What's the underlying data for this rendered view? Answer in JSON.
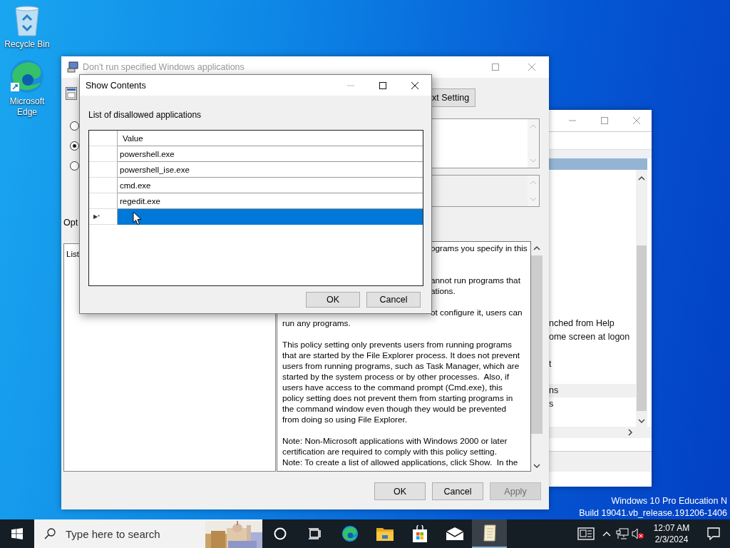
{
  "desktop_icons": [
    {
      "kind": "recycle",
      "label": "Recycle Bin"
    },
    {
      "kind": "edge",
      "label": "Microsoft Edge"
    }
  ],
  "back_window": {
    "items": [
      {
        "text": "nched from Help",
        "selected": false
      },
      {
        "text": "ome screen at logon",
        "selected": false
      },
      {
        "text": "t",
        "selected": false
      },
      {
        "text": "ns",
        "selected": true
      },
      {
        "text": "s",
        "selected": false
      }
    ]
  },
  "policy_window": {
    "title": "Don't run specified Windows applications",
    "active": false,
    "radios": [
      {
        "selected": false
      },
      {
        "selected": true
      },
      {
        "selected": false
      }
    ],
    "next_button": "xt Setting",
    "options_label": "Opt",
    "options_text": "List",
    "help_blocks": [
      {
        "lines": [
          {
            "text": "ograms you specify in this",
            "cut": true
          }
        ]
      },
      {
        "lines": [
          {
            "text": "annot run programs that",
            "cut": true
          },
          {
            "text": "ations.",
            "cut": true
          }
        ]
      },
      {
        "lines": [
          {
            "text": "ot configure it, users can",
            "cut": true
          },
          {
            "text": "run any programs.",
            "cut": false
          }
        ]
      },
      {
        "lines": [
          {
            "text": "This policy setting only prevents users from running programs",
            "cut": false
          },
          {
            "text": "that are started by the File Explorer process. It does not prevent",
            "cut": false
          },
          {
            "text": "users from running programs, such as Task Manager, which are",
            "cut": false
          },
          {
            "text": "started by the system process or by other processes.  Also, if",
            "cut": false
          },
          {
            "text": "users have access to the command prompt (Cmd.exe), this",
            "cut": false
          },
          {
            "text": "policy setting does not prevent them from starting programs in",
            "cut": false
          },
          {
            "text": "the command window even though they would be prevented",
            "cut": false
          },
          {
            "text": "from doing so using File Explorer.",
            "cut": false
          }
        ]
      },
      {
        "lines": [
          {
            "text": "Note: Non-Microsoft applications with Windows 2000 or later",
            "cut": false
          },
          {
            "text": "certification are required to comply with this policy setting.",
            "cut": false
          },
          {
            "text": "Note: To create a list of allowed applications, click Show.  In the",
            "cut": false
          }
        ]
      }
    ],
    "buttons": [
      {
        "label": "OK",
        "disabled": false
      },
      {
        "label": "Cancel",
        "disabled": false
      },
      {
        "label": "Apply",
        "disabled": true
      }
    ]
  },
  "dialog": {
    "title": "Show Contents",
    "label": "List of disallowed applications",
    "column": "Value",
    "rows": [
      {
        "value": "powershell.exe",
        "selected": false
      },
      {
        "value": "powershell_ise.exe",
        "selected": false
      },
      {
        "value": "cmd.exe",
        "selected": false
      },
      {
        "value": "regedit.exe",
        "selected": false
      },
      {
        "marker": "▶*",
        "selected": true
      }
    ],
    "buttons": [
      "OK",
      "Cancel"
    ]
  },
  "edition_lines": [
    "Windows 10 Pro Education N",
    "Build 19041.vb_release.191206-1406"
  ],
  "taskbar": {
    "search_placeholder": "Type here to search",
    "apps": [
      {
        "kind": "cortana",
        "active": false
      },
      {
        "kind": "taskview",
        "active": false
      },
      {
        "kind": "edge",
        "active": false
      },
      {
        "kind": "explorer",
        "active": false
      },
      {
        "kind": "store",
        "active": false
      },
      {
        "kind": "mail",
        "active": false
      },
      {
        "kind": "notepad",
        "active": true
      }
    ],
    "volume_muted": true,
    "time": "12:07 AM",
    "date": "2/3/2024"
  }
}
